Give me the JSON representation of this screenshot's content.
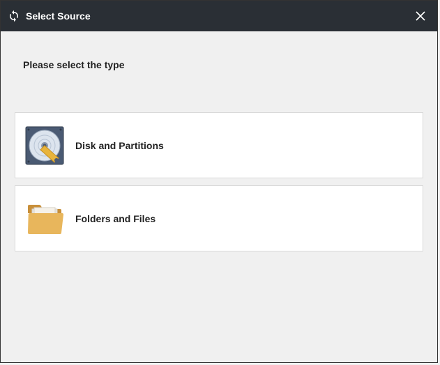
{
  "dialog": {
    "title": "Select Source",
    "instruction": "Please select the type",
    "options": [
      {
        "label": "Disk and Partitions",
        "icon": "disk-icon"
      },
      {
        "label": "Folders and Files",
        "icon": "folder-icon"
      }
    ]
  }
}
